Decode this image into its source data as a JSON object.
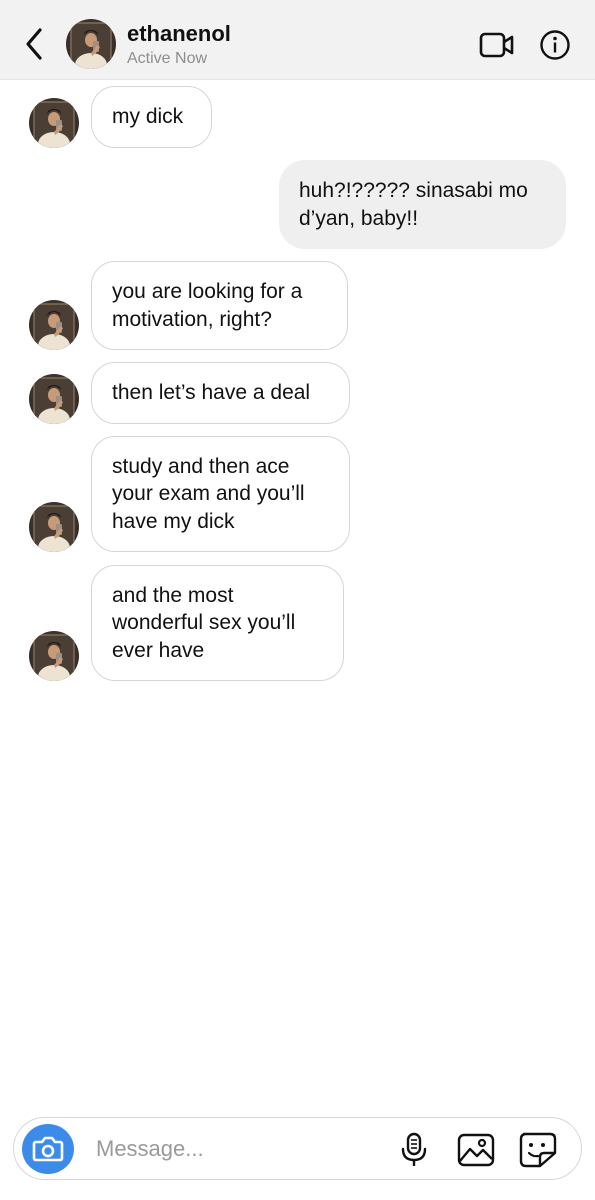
{
  "header": {
    "username": "ethanenol",
    "status": "Active Now",
    "back_icon": "chevron-left-icon",
    "video_icon": "video-camera-icon",
    "info_icon": "info-icon"
  },
  "messages": [
    {
      "direction": "incoming",
      "text": "my dick"
    },
    {
      "direction": "outgoing",
      "text": "huh?!????? sinasabi mo d’yan, baby!!"
    },
    {
      "direction": "incoming",
      "text": "you are looking for a motivation, right?"
    },
    {
      "direction": "incoming",
      "text": "then let’s have a deal"
    },
    {
      "direction": "incoming",
      "text": "study and then ace your exam and you’ll have my dick"
    },
    {
      "direction": "incoming",
      "text": "and the most wonderful sex you’ll ever have"
    }
  ],
  "composer": {
    "placeholder": "Message...",
    "camera_icon": "camera-icon",
    "mic_icon": "microphone-icon",
    "gallery_icon": "image-gallery-icon",
    "sticker_icon": "sticker-icon"
  },
  "colors": {
    "header_bg": "#f2f2f2",
    "outgoing_bubble": "#efefef",
    "incoming_border": "#d6d6d6",
    "camera_button": "#3d8be8",
    "secondary_text": "#8e8e8e"
  }
}
